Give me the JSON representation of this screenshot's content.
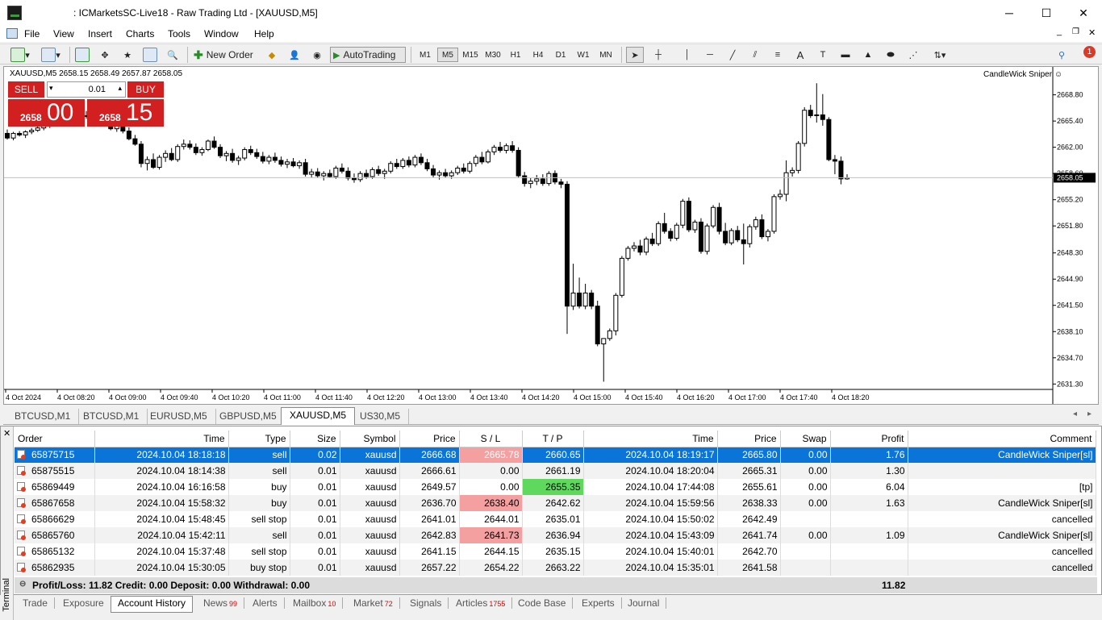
{
  "window": {
    "title": ": ICMarketsSC-Live18 - Raw Trading Ltd - [XAUUSD,M5]",
    "minimize": "─",
    "maximize": "☐",
    "close": "✕"
  },
  "menu": [
    "File",
    "View",
    "Insert",
    "Charts",
    "Tools",
    "Window",
    "Help"
  ],
  "toolbar": {
    "new_order": "New Order",
    "autotrading": "AutoTrading",
    "timeframes": [
      "M1",
      "M5",
      "M15",
      "M30",
      "H1",
      "H4",
      "D1",
      "W1",
      "MN"
    ],
    "active_tf": "M5",
    "notifications": "1"
  },
  "chart": {
    "header": "XAUUSD,M5  2658.15 2658.49 2657.87 2658.05",
    "ea": "CandleWick Sniper ☺",
    "current_price": "2658.05",
    "price_axis": [
      "2668.80",
      "2665.40",
      "2662.00",
      "2658.60",
      "2655.20",
      "2651.80",
      "2648.30",
      "2644.90",
      "2641.50",
      "2638.10",
      "2634.70",
      "2631.30"
    ],
    "time_axis": [
      "4 Oct 2024",
      "4 Oct 08:20",
      "4 Oct 09:00",
      "4 Oct 09:40",
      "4 Oct 10:20",
      "4 Oct 11:00",
      "4 Oct 11:40",
      "4 Oct 12:20",
      "4 Oct 13:00",
      "4 Oct 13:40",
      "4 Oct 14:20",
      "4 Oct 15:00",
      "4 Oct 15:40",
      "4 Oct 16:20",
      "4 Oct 17:00",
      "4 Oct 17:40",
      "4 Oct 18:20"
    ],
    "price_min": 2630.6,
    "price_max": 2672.0
  },
  "oneclick": {
    "sell": "SELL",
    "buy": "BUY",
    "lot": "0.01",
    "sell_small": "2658",
    "sell_big": "00",
    "buy_small": "2658",
    "buy_big": "15"
  },
  "symbol_tabs": [
    "BTCUSD,M1",
    "BTCUSD,M1",
    "EURUSD,M5",
    "GBPUSD,M5",
    "XAUUSD,M5",
    "US30,M5"
  ],
  "active_symbol_tab": "XAUUSD,M5",
  "terminal": {
    "side_label": "Terminal",
    "columns": [
      "Order",
      "Time",
      "Type",
      "Size",
      "Symbol",
      "Price",
      "S / L",
      "T / P",
      "Time",
      "Price",
      "Swap",
      "Profit",
      "Comment"
    ],
    "rows": [
      [
        "65875715",
        "2024.10.04 18:18:18",
        "sell",
        "0.02",
        "xauusd",
        "2666.68",
        "2665.78",
        "2660.65",
        "2024.10.04 18:19:17",
        "2665.80",
        "0.00",
        "1.76",
        "CandleWick Sniper[sl]"
      ],
      [
        "65875515",
        "2024.10.04 18:14:38",
        "sell",
        "0.01",
        "xauusd",
        "2666.61",
        "0.00",
        "2661.19",
        "2024.10.04 18:20:04",
        "2665.31",
        "0.00",
        "1.30",
        ""
      ],
      [
        "65869449",
        "2024.10.04 16:16:58",
        "buy",
        "0.01",
        "xauusd",
        "2649.57",
        "0.00",
        "2655.35",
        "2024.10.04 17:44:08",
        "2655.61",
        "0.00",
        "6.04",
        "[tp]"
      ],
      [
        "65867658",
        "2024.10.04 15:58:32",
        "buy",
        "0.01",
        "xauusd",
        "2636.70",
        "2638.40",
        "2642.62",
        "2024.10.04 15:59:56",
        "2638.33",
        "0.00",
        "1.63",
        "CandleWick Sniper[sl]"
      ],
      [
        "65866629",
        "2024.10.04 15:48:45",
        "sell stop",
        "0.01",
        "xauusd",
        "2641.01",
        "2644.01",
        "2635.01",
        "2024.10.04 15:50:02",
        "2642.49",
        "",
        "",
        "cancelled"
      ],
      [
        "65865760",
        "2024.10.04 15:42:11",
        "sell",
        "0.01",
        "xauusd",
        "2642.83",
        "2641.73",
        "2636.94",
        "2024.10.04 15:43:09",
        "2641.74",
        "0.00",
        "1.09",
        "CandleWick Sniper[sl]"
      ],
      [
        "65865132",
        "2024.10.04 15:37:48",
        "sell stop",
        "0.01",
        "xauusd",
        "2641.15",
        "2644.15",
        "2635.15",
        "2024.10.04 15:40:01",
        "2642.70",
        "",
        "",
        "cancelled"
      ],
      [
        "65862935",
        "2024.10.04 15:30:05",
        "buy stop",
        "0.01",
        "xauusd",
        "2657.22",
        "2654.22",
        "2663.22",
        "2024.10.04 15:35:01",
        "2641.58",
        "",
        "",
        "cancelled"
      ]
    ],
    "summary": "Profit/Loss: 11.82  Credit: 0.00  Deposit: 0.00  Withdrawal: 0.00",
    "summary_total": "11.82",
    "tabs": [
      {
        "label": "Trade",
        "badge": ""
      },
      {
        "label": "Exposure",
        "badge": ""
      },
      {
        "label": "Account History",
        "badge": ""
      },
      {
        "label": "News",
        "badge": "99"
      },
      {
        "label": "Alerts",
        "badge": ""
      },
      {
        "label": "Mailbox",
        "badge": "10"
      },
      {
        "label": "Market",
        "badge": "72"
      },
      {
        "label": "Signals",
        "badge": ""
      },
      {
        "label": "Articles",
        "badge": "1755"
      },
      {
        "label": "Code Base",
        "badge": ""
      },
      {
        "label": "Experts",
        "badge": ""
      },
      {
        "label": "Journal",
        "badge": ""
      }
    ],
    "active_tab": "Account History"
  },
  "candles": [
    [
      2663.8,
      2664.3,
      2663.0,
      2663.2
    ],
    [
      2663.2,
      2664.0,
      2662.9,
      2663.8
    ],
    [
      2663.8,
      2664.1,
      2663.4,
      2663.6
    ],
    [
      2663.6,
      2664.2,
      2663.2,
      2664.0
    ],
    [
      2664.0,
      2664.5,
      2663.7,
      2664.2
    ],
    [
      2664.2,
      2664.9,
      2664.0,
      2664.5
    ],
    [
      2664.5,
      2665.2,
      2664.2,
      2664.9
    ],
    [
      2664.9,
      2665.6,
      2664.5,
      2665.2
    ],
    [
      2665.2,
      2665.8,
      2664.8,
      2665.5
    ],
    [
      2665.5,
      2666.0,
      2665.0,
      2665.3
    ],
    [
      2665.3,
      2665.9,
      2664.9,
      2665.6
    ],
    [
      2665.6,
      2666.2,
      2665.2,
      2665.9
    ],
    [
      2665.9,
      2666.4,
      2665.4,
      2666.1
    ],
    [
      2666.1,
      2666.7,
      2665.7,
      2666.0
    ],
    [
      2666.0,
      2666.5,
      2665.4,
      2665.6
    ],
    [
      2665.6,
      2666.1,
      2665.0,
      2665.2
    ],
    [
      2665.2,
      2665.9,
      2664.7,
      2665.0
    ],
    [
      2665.0,
      2665.5,
      2664.2,
      2664.4
    ],
    [
      2664.4,
      2665.1,
      2664.0,
      2664.8
    ],
    [
      2664.8,
      2665.2,
      2663.8,
      2664.1
    ],
    [
      2664.1,
      2664.6,
      2662.9,
      2663.1
    ],
    [
      2663.1,
      2663.6,
      2662.2,
      2662.4
    ],
    [
      2662.4,
      2662.8,
      2659.4,
      2659.9
    ],
    [
      2659.9,
      2660.8,
      2659.0,
      2660.4
    ],
    [
      2660.4,
      2661.2,
      2659.2,
      2659.4
    ],
    [
      2659.4,
      2661.0,
      2659.1,
      2660.7
    ],
    [
      2660.7,
      2661.6,
      2660.1,
      2661.2
    ],
    [
      2661.2,
      2661.9,
      2660.2,
      2660.4
    ],
    [
      2660.4,
      2662.4,
      2660.1,
      2662.1
    ],
    [
      2662.1,
      2663.0,
      2661.7,
      2662.4
    ],
    [
      2662.4,
      2662.9,
      2661.7,
      2662.0
    ],
    [
      2662.0,
      2662.5,
      2661.0,
      2661.3
    ],
    [
      2661.3,
      2662.0,
      2660.9,
      2661.7
    ],
    [
      2661.7,
      2663.0,
      2661.5,
      2662.8
    ],
    [
      2662.8,
      2663.4,
      2661.8,
      2662.0
    ],
    [
      2662.0,
      2662.4,
      2660.6,
      2660.9
    ],
    [
      2660.9,
      2661.5,
      2660.2,
      2661.2
    ],
    [
      2661.2,
      2661.8,
      2660.0,
      2660.3
    ],
    [
      2660.3,
      2660.9,
      2659.7,
      2660.6
    ],
    [
      2660.6,
      2662.0,
      2660.3,
      2661.7
    ],
    [
      2661.7,
      2662.2,
      2661.0,
      2661.3
    ],
    [
      2661.3,
      2661.8,
      2660.5,
      2660.8
    ],
    [
      2660.8,
      2661.4,
      2659.9,
      2660.2
    ],
    [
      2660.2,
      2661.0,
      2659.8,
      2660.7
    ],
    [
      2660.7,
      2661.3,
      2660.0,
      2660.3
    ],
    [
      2660.3,
      2660.8,
      2659.5,
      2659.8
    ],
    [
      2659.8,
      2660.5,
      2659.3,
      2660.1
    ],
    [
      2660.1,
      2660.6,
      2659.4,
      2659.6
    ],
    [
      2659.6,
      2660.3,
      2659.2,
      2660.0
    ],
    [
      2660.0,
      2660.5,
      2658.2,
      2658.5
    ],
    [
      2658.5,
      2659.2,
      2658.1,
      2658.8
    ],
    [
      2658.8,
      2659.3,
      2658.0,
      2658.3
    ],
    [
      2658.3,
      2658.9,
      2657.7,
      2658.6
    ],
    [
      2658.6,
      2659.1,
      2658.0,
      2658.2
    ],
    [
      2658.2,
      2659.6,
      2657.9,
      2659.3
    ],
    [
      2659.3,
      2659.9,
      2658.6,
      2658.9
    ],
    [
      2658.9,
      2659.4,
      2657.7,
      2658.0
    ],
    [
      2658.0,
      2658.6,
      2657.4,
      2657.8
    ],
    [
      2657.8,
      2658.9,
      2657.5,
      2658.6
    ],
    [
      2658.6,
      2659.1,
      2657.9,
      2658.2
    ],
    [
      2658.2,
      2659.4,
      2657.9,
      2659.1
    ],
    [
      2659.1,
      2659.6,
      2658.3,
      2658.6
    ],
    [
      2658.6,
      2659.2,
      2657.9,
      2658.9
    ],
    [
      2658.9,
      2660.2,
      2658.6,
      2659.9
    ],
    [
      2659.9,
      2660.5,
      2659.2,
      2659.5
    ],
    [
      2659.5,
      2660.6,
      2659.2,
      2660.3
    ],
    [
      2660.3,
      2660.8,
      2659.4,
      2659.7
    ],
    [
      2659.7,
      2661.0,
      2659.4,
      2660.7
    ],
    [
      2660.7,
      2661.2,
      2659.7,
      2660.0
    ],
    [
      2660.0,
      2660.5,
      2658.9,
      2659.2
    ],
    [
      2659.2,
      2659.7,
      2658.1,
      2658.4
    ],
    [
      2658.4,
      2659.0,
      2657.8,
      2658.7
    ],
    [
      2658.7,
      2659.2,
      2658.0,
      2658.3
    ],
    [
      2658.3,
      2659.0,
      2657.9,
      2658.7
    ],
    [
      2658.7,
      2659.6,
      2658.4,
      2659.3
    ],
    [
      2659.3,
      2659.9,
      2658.6,
      2658.9
    ],
    [
      2658.9,
      2660.2,
      2658.6,
      2659.9
    ],
    [
      2659.9,
      2661.0,
      2659.5,
      2660.7
    ],
    [
      2660.7,
      2661.4,
      2659.8,
      2660.1
    ],
    [
      2660.1,
      2661.7,
      2659.9,
      2661.4
    ],
    [
      2661.4,
      2662.3,
      2661.0,
      2662.0
    ],
    [
      2662.0,
      2662.7,
      2661.3,
      2661.6
    ],
    [
      2661.6,
      2662.5,
      2661.2,
      2662.2
    ],
    [
      2662.2,
      2662.8,
      2661.3,
      2661.6
    ],
    [
      2661.6,
      2662.0,
      2658.0,
      2658.3
    ],
    [
      2658.3,
      2658.8,
      2656.9,
      2657.3
    ],
    [
      2657.3,
      2658.0,
      2656.7,
      2657.6
    ],
    [
      2657.6,
      2658.4,
      2657.1,
      2657.9
    ],
    [
      2657.9,
      2658.5,
      2657.0,
      2657.3
    ],
    [
      2657.3,
      2658.9,
      2657.0,
      2658.6
    ],
    [
      2658.6,
      2659.0,
      2657.2,
      2657.5
    ],
    [
      2657.5,
      2657.9,
      2656.7,
      2657.2
    ],
    [
      2657.2,
      2657.6,
      2637.8,
      2641.4
    ],
    [
      2641.4,
      2646.9,
      2640.9,
      2643.1
    ],
    [
      2643.1,
      2645.1,
      2641.1,
      2641.4
    ],
    [
      2641.4,
      2644.3,
      2641.0,
      2643.1
    ],
    [
      2643.1,
      2643.5,
      2641.0,
      2641.4
    ],
    [
      2641.4,
      2642.1,
      2636.2,
      2636.5
    ],
    [
      2636.5,
      2637.2,
      2631.6,
      2637.2
    ],
    [
      2637.2,
      2638.5,
      2636.9,
      2638.2
    ],
    [
      2638.2,
      2643.1,
      2637.6,
      2642.8
    ],
    [
      2642.8,
      2647.9,
      2642.5,
      2647.6
    ],
    [
      2647.6,
      2649.2,
      2647.3,
      2648.9
    ],
    [
      2648.9,
      2649.7,
      2648.5,
      2649.2
    ],
    [
      2649.2,
      2650.0,
      2648.0,
      2648.4
    ],
    [
      2648.4,
      2650.4,
      2648.0,
      2650.1
    ],
    [
      2650.1,
      2650.9,
      2649.2,
      2649.5
    ],
    [
      2649.5,
      2652.4,
      2649.2,
      2652.1
    ],
    [
      2652.1,
      2653.5,
      2650.8,
      2651.1
    ],
    [
      2651.1,
      2651.5,
      2649.8,
      2650.2
    ],
    [
      2650.2,
      2652.2,
      2649.9,
      2651.9
    ],
    [
      2651.9,
      2655.3,
      2651.5,
      2655.0
    ],
    [
      2655.0,
      2655.5,
      2651.0,
      2651.3
    ],
    [
      2651.3,
      2652.6,
      2650.9,
      2652.3
    ],
    [
      2652.3,
      2652.8,
      2648.2,
      2648.5
    ],
    [
      2648.5,
      2652.1,
      2648.1,
      2651.8
    ],
    [
      2651.8,
      2654.5,
      2651.5,
      2654.2
    ],
    [
      2654.2,
      2654.8,
      2650.7,
      2651.1
    ],
    [
      2651.1,
      2652.2,
      2649.3,
      2649.6
    ],
    [
      2649.6,
      2651.5,
      2649.3,
      2651.2
    ],
    [
      2651.2,
      2651.8,
      2649.7,
      2650.0
    ],
    [
      2650.0,
      2652.1,
      2646.8,
      2649.5
    ],
    [
      2649.5,
      2652.0,
      2649.0,
      2651.7
    ],
    [
      2651.7,
      2653.0,
      2651.3,
      2652.6
    ],
    [
      2652.6,
      2653.3,
      2650.1,
      2650.4
    ],
    [
      2650.4,
      2651.4,
      2649.8,
      2651.1
    ],
    [
      2651.1,
      2655.9,
      2650.8,
      2655.6
    ],
    [
      2655.6,
      2656.5,
      2655.2,
      2655.9
    ],
    [
      2655.9,
      2660.3,
      2655.0,
      2658.7
    ],
    [
      2658.7,
      2659.4,
      2658.2,
      2659.0
    ],
    [
      2659.0,
      2662.8,
      2658.6,
      2662.5
    ],
    [
      2662.5,
      2667.2,
      2662.1,
      2666.8
    ],
    [
      2666.8,
      2667.5,
      2665.8,
      2666.1
    ],
    [
      2666.1,
      2670.3,
      2665.2,
      2666.2
    ],
    [
      2666.2,
      2668.9,
      2664.8,
      2665.6
    ],
    [
      2665.6,
      2665.9,
      2660.2,
      2660.4
    ],
    [
      2660.4,
      2661.0,
      2658.5,
      2660.2
    ],
    [
      2660.2,
      2660.8,
      2657.2,
      2657.9
    ],
    [
      2657.9,
      2658.5,
      2657.8,
      2658.05
    ]
  ]
}
